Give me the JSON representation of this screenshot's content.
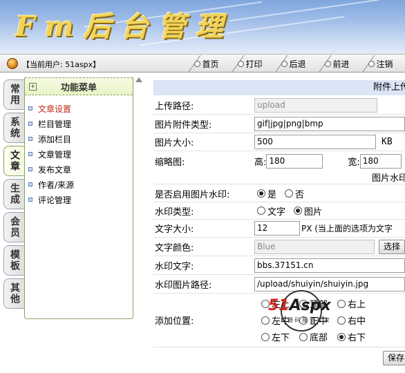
{
  "banner": {
    "title": "Fm后台管理"
  },
  "navbar": {
    "current_user": "【当前用户: 51aspx】",
    "items": [
      "首页",
      "打印",
      "后退",
      "前进",
      "注销"
    ]
  },
  "left_tabs": [
    "常用",
    "系统",
    "文章",
    "生成",
    "会员",
    "模板",
    "其他"
  ],
  "left_tabs_active": "文章",
  "side_menu": {
    "title": "功能菜单",
    "items": [
      "文章设置",
      "栏目管理",
      "添加栏目",
      "文章管理",
      "发布文章",
      "作者/来源",
      "评论管理"
    ],
    "active": "文章设置"
  },
  "form": {
    "header": "附件上传",
    "upload_path": {
      "label": "上传路径:",
      "value": "upload"
    },
    "image_types": {
      "label": "图片附件类型:",
      "value": "gif|jpg|png|bmp"
    },
    "image_size": {
      "label": "图片大小:",
      "value": "500",
      "unit": "KB"
    },
    "thumbnail": {
      "label": "缩略图:",
      "height_label": "高:",
      "height": "180",
      "width_label": "宽:",
      "width": "180"
    },
    "image_watermark_note": "图片水印",
    "enable_watermark": {
      "label": "是否启用图片水印:",
      "options": [
        "是",
        "否"
      ],
      "selected": "是"
    },
    "watermark_type": {
      "label": "水印类型:",
      "options": [
        "文字",
        "图片"
      ],
      "selected": "图片"
    },
    "text_size": {
      "label": "文字大小:",
      "value": "12",
      "note": "PX (当上面的选项为文字"
    },
    "text_color": {
      "label": "文字颜色:",
      "value": "Blue",
      "button": "选择"
    },
    "watermark_text": {
      "label": "水印文字:",
      "value": "bbs.37151.cn"
    },
    "watermark_image_path": {
      "label": "水印图片路径:",
      "value": "/upload/shuiyin/shuiyin.jpg"
    },
    "position": {
      "label": "添加位置:",
      "rows": [
        [
          "左上",
          "顶部",
          "右上"
        ],
        [
          "左中",
          "正中",
          "右中"
        ],
        [
          "左下",
          "底部",
          "右下"
        ]
      ],
      "selected": "右下"
    },
    "save_button": "保存"
  },
  "watermark_logo": {
    "brand_red": "51",
    "brand_black": "Aspx",
    "sub": "源 码 服 务 专 家"
  }
}
